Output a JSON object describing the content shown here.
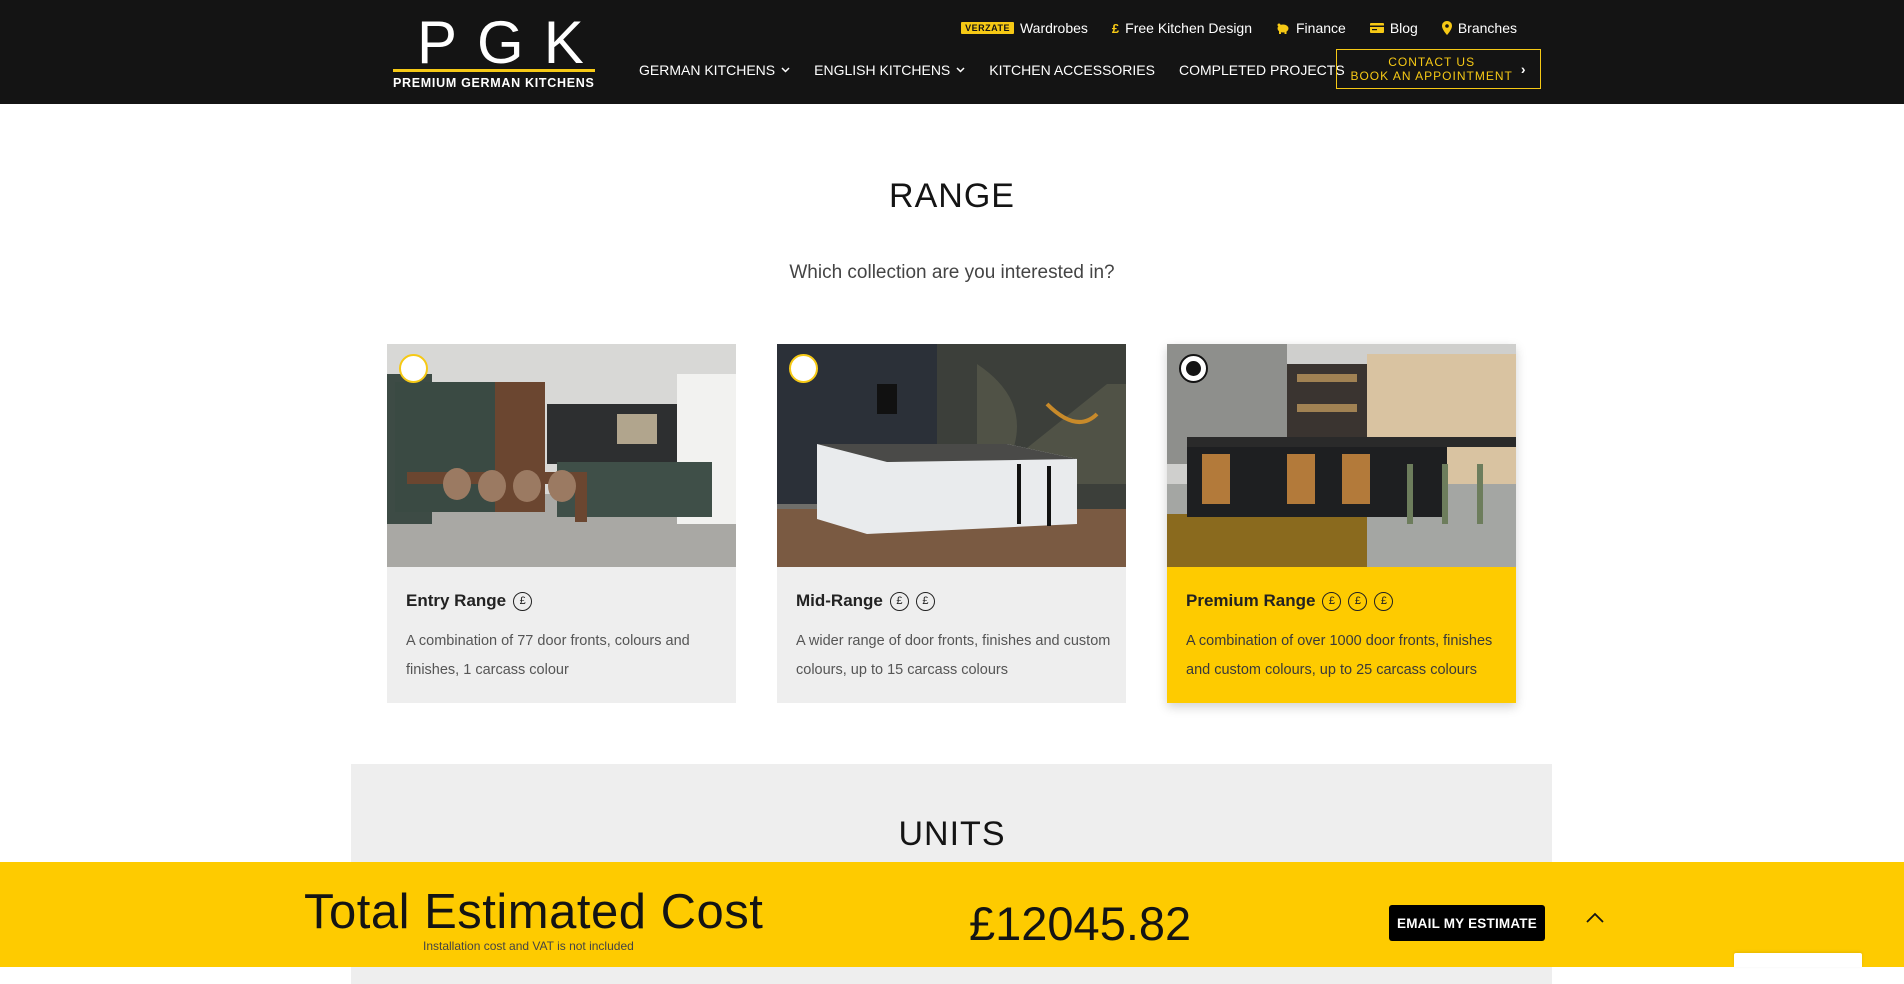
{
  "brand": {
    "logo_letters": "PGK",
    "logo_sub": "PREMIUM GERMAN KITCHENS",
    "accent_color": "#f6c915",
    "header_bg": "#141414"
  },
  "topnav": {
    "wardrobes_badge": "VERZATE",
    "wardrobes": "Wardrobes",
    "free_design": "Free Kitchen Design",
    "finance": "Finance",
    "blog": "Blog",
    "branches": "Branches"
  },
  "mainnav": {
    "german": "GERMAN KITCHENS",
    "english": "ENGLISH KITCHENS",
    "accessories": "KITCHEN ACCESSORIES",
    "projects": "COMPLETED PROJECTS"
  },
  "contact": {
    "line1": "CONTACT US",
    "line2": "BOOK AN APPOINTMENT"
  },
  "range": {
    "title": "RANGE",
    "subtitle": "Which collection are you interested in?",
    "cards": [
      {
        "title": "Entry Range",
        "pounds": 1,
        "desc": "A combination of 77 door fronts, colours and finishes, 1 carcass colour",
        "selected": false
      },
      {
        "title": "Mid-Range",
        "pounds": 2,
        "desc": "A wider range of door fronts, finishes and custom colours, up to 15 carcass colours",
        "selected": false
      },
      {
        "title": "Premium Range",
        "pounds": 3,
        "desc": "A combination of over 1000 door fronts, finishes and custom colours, up to 25 carcass colours",
        "selected": true
      }
    ]
  },
  "units": {
    "title": "UNITS"
  },
  "estimate": {
    "label": "Total Estimated Cost",
    "note": "Installation cost and VAT is not included",
    "value": "£12045.82",
    "email_button": "EMAIL MY ESTIMATE",
    "bar_color": "#fecb00"
  },
  "icons": {
    "free_design": "pound-icon",
    "finance": "piggy-bank-icon",
    "blog": "card-icon",
    "branches": "map-pin-icon",
    "pound_symbol": "£",
    "chevron": "⌄",
    "arrow": "›",
    "up": "︿"
  }
}
